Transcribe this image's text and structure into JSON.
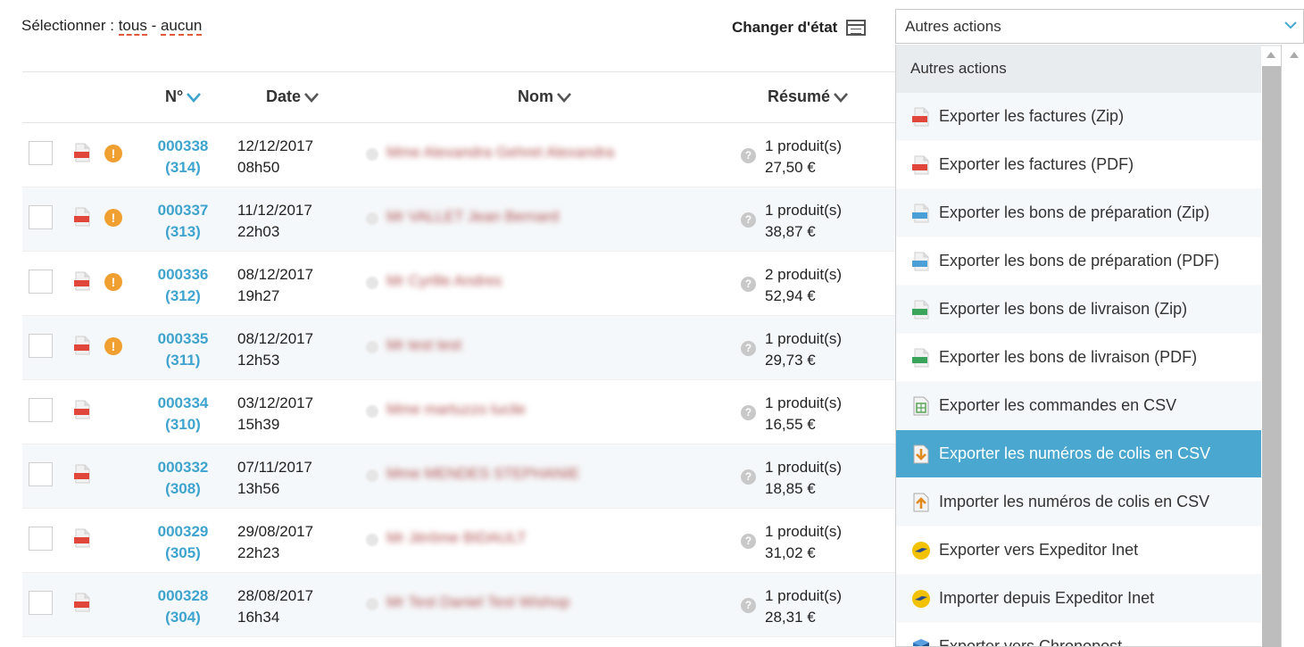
{
  "selection": {
    "label": "Sélectionner :",
    "all": "tous",
    "sep": "-",
    "none": "aucun"
  },
  "change_state": {
    "label": "Changer d'état",
    "icon": "state-window-icon"
  },
  "actions_select": {
    "value": "Autres actions"
  },
  "table": {
    "columns": {
      "num": "N°",
      "date": "Date",
      "name": "Nom",
      "summary": "Résumé"
    },
    "rows": [
      {
        "num": "000338",
        "sub": "(314)",
        "date": "12/12/2017",
        "time": "08h50",
        "name": "Mme Alexandra Gehret Alexandra",
        "products": "1 produit(s)",
        "price": "27,50 €",
        "warning": true
      },
      {
        "num": "000337",
        "sub": "(313)",
        "date": "11/12/2017",
        "time": "22h03",
        "name": "Mr VALLET Jean Bernard",
        "products": "1 produit(s)",
        "price": "38,87 €",
        "warning": true
      },
      {
        "num": "000336",
        "sub": "(312)",
        "date": "08/12/2017",
        "time": "19h27",
        "name": "Mr Cyrille Andres",
        "products": "2 produit(s)",
        "price": "52,94 €",
        "warning": true
      },
      {
        "num": "000335",
        "sub": "(311)",
        "date": "08/12/2017",
        "time": "12h53",
        "name": "Mr test test",
        "products": "1 produit(s)",
        "price": "29,73 €",
        "warning": true
      },
      {
        "num": "000334",
        "sub": "(310)",
        "date": "03/12/2017",
        "time": "15h39",
        "name": "Mme martuzzo lucile",
        "products": "1 produit(s)",
        "price": "16,55 €",
        "warning": false
      },
      {
        "num": "000332",
        "sub": "(308)",
        "date": "07/11/2017",
        "time": "13h56",
        "name": "Mme MENDES STEPHANIE",
        "products": "1 produit(s)",
        "price": "18,85 €",
        "warning": false
      },
      {
        "num": "000329",
        "sub": "(305)",
        "date": "29/08/2017",
        "time": "22h23",
        "name": "Mr Jérôme BIDAULT",
        "products": "1 produit(s)",
        "price": "31,02 €",
        "warning": false
      },
      {
        "num": "000328",
        "sub": "(304)",
        "date": "28/08/2017",
        "time": "16h34",
        "name": "Mr Test Daniel Test Wishop",
        "products": "1 produit(s)",
        "price": "28,31 €",
        "warning": false
      }
    ]
  },
  "dropdown": {
    "header": "Autres actions",
    "items": [
      {
        "label": "Exporter les factures (Zip)",
        "icon": "pdf-red-icon",
        "color": "#e0473a"
      },
      {
        "label": "Exporter les factures (PDF)",
        "icon": "pdf-red-icon",
        "color": "#e0473a"
      },
      {
        "label": "Exporter les bons de préparation (Zip)",
        "icon": "pdf-blue-icon",
        "color": "#4a9fd6"
      },
      {
        "label": "Exporter les bons de préparation (PDF)",
        "icon": "pdf-blue-icon",
        "color": "#4a9fd6"
      },
      {
        "label": "Exporter les bons de livraison (Zip)",
        "icon": "pdf-green-icon",
        "color": "#3aa55a"
      },
      {
        "label": "Exporter les bons de livraison (PDF)",
        "icon": "pdf-green-icon",
        "color": "#3aa55a"
      },
      {
        "label": "Exporter les commandes en CSV",
        "icon": "csv-sheet-icon",
        "color": "#5aa55a"
      },
      {
        "label": "Exporter les numéros de colis en CSV",
        "icon": "csv-export-icon",
        "color": "#e08a20"
      },
      {
        "label": "Importer les numéros de colis en CSV",
        "icon": "csv-import-icon",
        "color": "#e08a20"
      },
      {
        "label": "Exporter vers Expeditor Inet",
        "icon": "laposte-logo-icon",
        "color": "#f2c200"
      },
      {
        "label": "Importer depuis Expeditor Inet",
        "icon": "laposte-logo-icon",
        "color": "#f2c200"
      },
      {
        "label": "Exporter vers Chronopost",
        "icon": "chronopost-box-icon",
        "color": "#2a6fb8"
      }
    ]
  },
  "colors": {
    "link": "#3ea3cf",
    "active_item": "#4aa8d0",
    "warning": "#f0a030",
    "dashed_underline": "#e05a3a"
  }
}
